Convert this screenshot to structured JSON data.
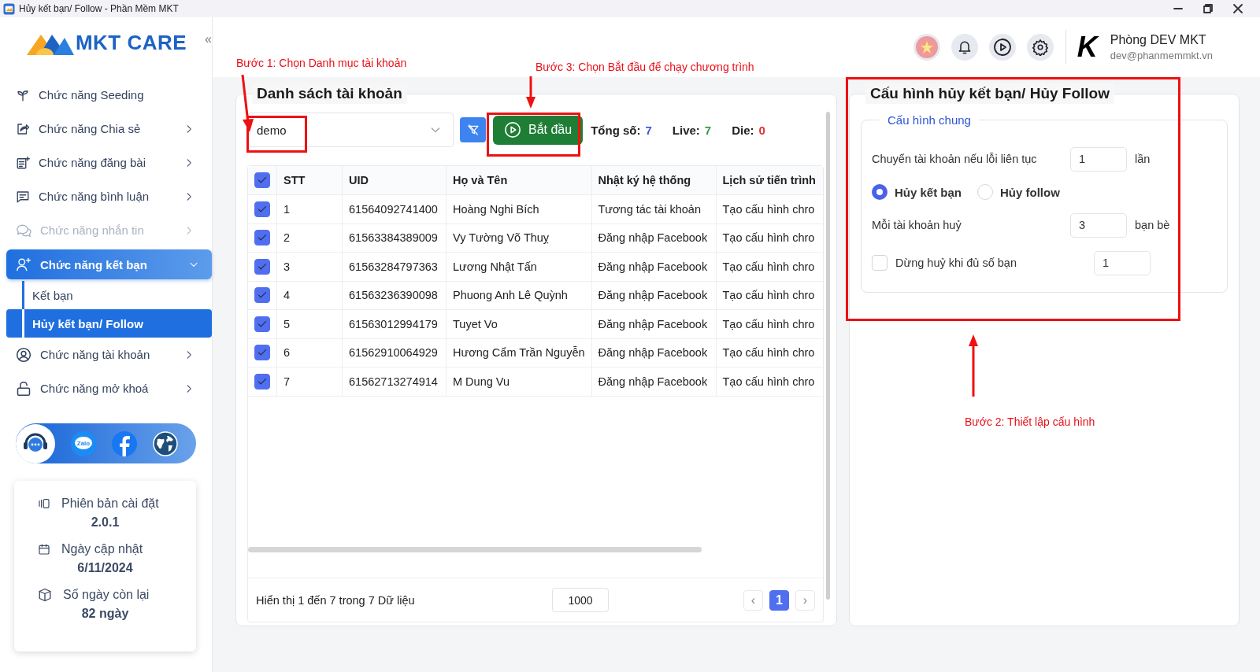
{
  "window": {
    "title": "Hủy kết bạn/ Follow - Phần Mềm MKT"
  },
  "sidebar": {
    "logo": "MKT CARE",
    "items": [
      {
        "label": "Chức năng Seeding",
        "has_arrow": false,
        "disabled": false,
        "expanded": false
      },
      {
        "label": "Chức năng Chia sẻ",
        "has_arrow": true,
        "disabled": false,
        "expanded": false
      },
      {
        "label": "Chức năng đăng bài",
        "has_arrow": true,
        "disabled": false,
        "expanded": false
      },
      {
        "label": "Chức năng bình luận",
        "has_arrow": true,
        "disabled": false,
        "expanded": false
      },
      {
        "label": "Chức năng nhắn tin",
        "has_arrow": true,
        "disabled": true,
        "expanded": false
      },
      {
        "label": "Chức năng kết bạn",
        "has_arrow": true,
        "disabled": false,
        "expanded": true,
        "children": [
          {
            "label": "Kết bạn",
            "selected": false
          },
          {
            "label": "Hủy kết bạn/ Follow",
            "selected": true
          }
        ]
      },
      {
        "label": "Chức năng tài khoản",
        "has_arrow": true,
        "disabled": false,
        "expanded": false
      },
      {
        "label": "Chức năng mở khoá",
        "has_arrow": true,
        "disabled": false,
        "expanded": false
      }
    ],
    "social": [
      {
        "kind": "support"
      },
      {
        "kind": "zalo",
        "label": "Zalo"
      },
      {
        "kind": "facebook"
      },
      {
        "kind": "globe"
      }
    ],
    "info": [
      {
        "label": "Phiên bản cài đặt",
        "value": "2.0.1"
      },
      {
        "label": "Ngày cập nhật",
        "value": "6/11/2024"
      },
      {
        "label": "Số ngày còn lại",
        "value": "82 ngày"
      }
    ]
  },
  "header": {
    "collapse": "«",
    "user": {
      "logo": "K",
      "name": "Phòng DEV MKT",
      "email": "dev@phanmemmkt.vn"
    }
  },
  "accounts": {
    "title": "Danh sách tài khoản",
    "category": "demo",
    "start": "Bắt đầu",
    "stats": [
      {
        "label": "Tổng số:",
        "value": "7",
        "color": "#3b5bdb"
      },
      {
        "label": "Live:",
        "value": "7",
        "color": "#2f9e44"
      },
      {
        "label": "Die:",
        "value": "0",
        "color": "#e03131"
      }
    ],
    "table": {
      "all_checked": true,
      "columns": [
        "STT",
        "UID",
        "Họ và Tên",
        "Nhật ký hệ thống",
        "Lịch sử tiến trình"
      ],
      "rows": [
        {
          "checked": true,
          "cells": [
            "1",
            "61564092741400",
            "Hoàng Nghi Bích",
            "Tương tác tài khoản",
            "Tạo cấu hình chro"
          ]
        },
        {
          "checked": true,
          "cells": [
            "2",
            "61563384389009",
            "Vy Tường Võ Thuỵ",
            "Đăng nhập Facebook",
            "Tạo cấu hình chro"
          ]
        },
        {
          "checked": true,
          "cells": [
            "3",
            "61563284797363",
            "Lương Nhật Tấn",
            "Đăng nhập Facebook",
            "Tạo cấu hình chro"
          ]
        },
        {
          "checked": true,
          "cells": [
            "4",
            "61563236390098",
            "Phuong Anh Lê Quỳnh",
            "Đăng nhập Facebook",
            "Tạo cấu hình chro"
          ]
        },
        {
          "checked": true,
          "cells": [
            "5",
            "61563012994179",
            "Tuyet Vo",
            "Đăng nhập Facebook",
            "Tạo cấu hình chro"
          ]
        },
        {
          "checked": true,
          "cells": [
            "6",
            "61562910064929",
            "Hương Cẩm Trần Nguyễn",
            "Đăng nhập Facebook",
            "Tạo cấu hình chro"
          ]
        },
        {
          "checked": true,
          "cells": [
            "7",
            "61562713274914",
            "M Dung Vu",
            "Đăng nhập Facebook",
            "Tạo cấu hình chro"
          ]
        }
      ]
    },
    "footer": {
      "summary": "Hiển thị 1 đến 7 trong 7 Dữ liệu",
      "page_size": "1000",
      "prev": "‹",
      "next": "›",
      "pages": [
        {
          "label": "1",
          "selected": true
        }
      ]
    }
  },
  "config": {
    "title": "Cấu hình hủy kết bạn/ Hủy Follow",
    "group": "Cấu hình chung",
    "rows": [
      {
        "kind": "number",
        "label": "Chuyển tài khoản nếu lỗi liên tục",
        "value": "1",
        "unit": "lần"
      },
      {
        "kind": "radio",
        "options": [
          {
            "label": "Hủy kết bạn",
            "selected": true
          },
          {
            "label": "Hủy follow",
            "selected": false
          }
        ]
      },
      {
        "kind": "number",
        "label": "Mỗi tài khoản huỷ",
        "value": "3",
        "unit": "bạn bè"
      },
      {
        "kind": "checkbox",
        "label": "Dừng huỷ khi đủ số bạn",
        "checked": false,
        "value": "1"
      }
    ]
  },
  "annotations": [
    {
      "text": "Bước 1: Chọn Danh mục tài khoản"
    },
    {
      "text": "Bước 3: Chọn Bắt đầu để chạy chương trình"
    },
    {
      "text": "Bước 2: Thiết lập cấu hình"
    }
  ]
}
